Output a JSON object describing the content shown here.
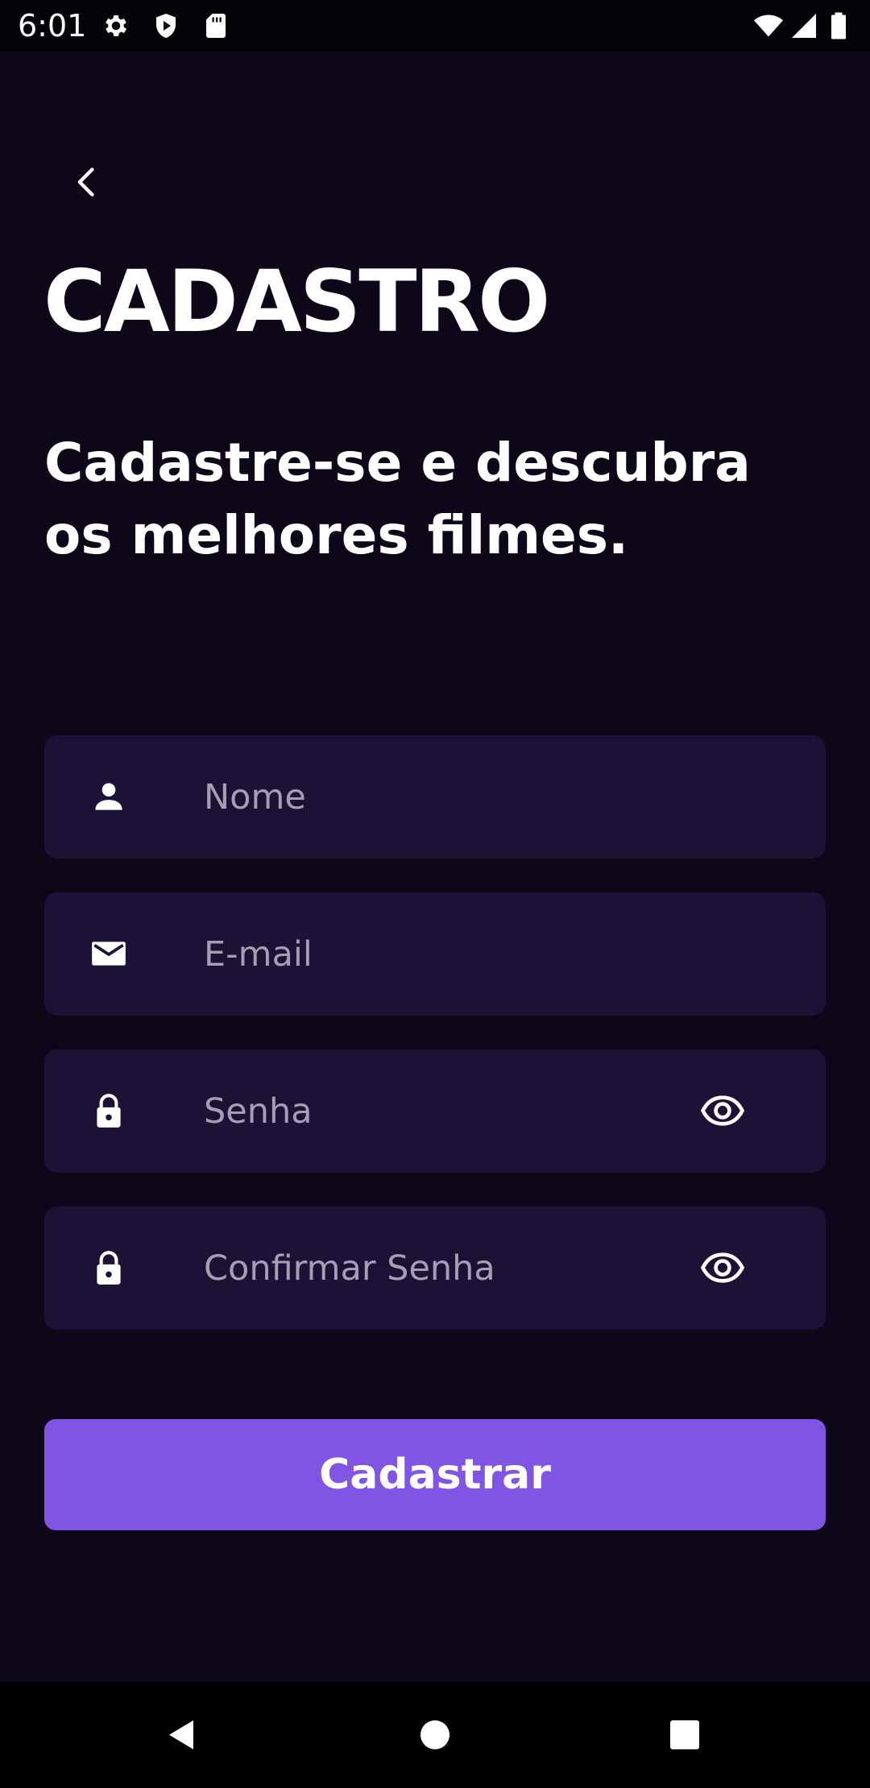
{
  "status_bar": {
    "time": "6:01",
    "icons": [
      "settings-icon",
      "shield-play-icon",
      "sd-card-icon",
      "wifi-icon",
      "cellular-signal-icon",
      "battery-icon"
    ]
  },
  "header": {
    "back_icon": "chevron-left-icon",
    "title": "CADASTRO",
    "subtitle": "Cadastre-se e descubra os melhores filmes."
  },
  "form": {
    "name": {
      "placeholder": "Nome",
      "value": "",
      "icon": "person-icon"
    },
    "email": {
      "placeholder": "E-mail",
      "value": "",
      "icon": "mail-icon"
    },
    "password": {
      "placeholder": "Senha",
      "value": "",
      "icon": "lock-icon",
      "toggle_icon": "eye-icon"
    },
    "confirm_password": {
      "placeholder": "Confirmar Senha",
      "value": "",
      "icon": "lock-icon",
      "toggle_icon": "eye-icon"
    },
    "submit_label": "Cadastrar"
  },
  "nav_bar": {
    "icons": [
      "back-triangle-icon",
      "home-circle-icon",
      "recents-square-icon"
    ]
  },
  "colors": {
    "background": "#0d0719",
    "field_background": "#1d1236",
    "accent": "#8155e3",
    "placeholder": "#a49fb4",
    "text": "#ffffff"
  }
}
